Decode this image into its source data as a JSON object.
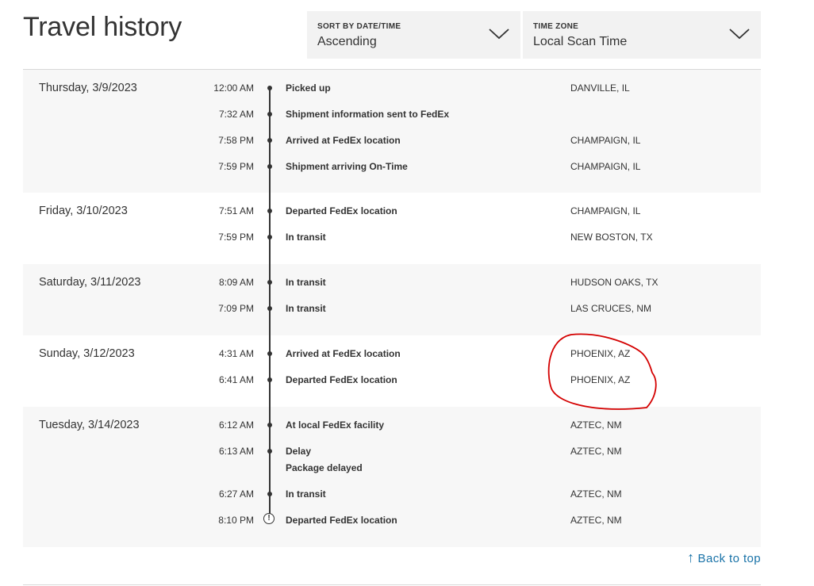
{
  "page": {
    "title": "Travel history"
  },
  "controls": {
    "sort": {
      "label": "SORT BY DATE/TIME",
      "value": "Ascending"
    },
    "timezone": {
      "label": "TIME ZONE",
      "value": "Local Scan Time"
    }
  },
  "history": [
    {
      "date": "Thursday, 3/9/2023",
      "events": [
        {
          "time": "12:00 AM",
          "description": "Picked up",
          "location": "DANVILLE, IL"
        },
        {
          "time": "7:32 AM",
          "description": "Shipment information sent to FedEx",
          "location": ""
        },
        {
          "time": "7:58 PM",
          "description": "Arrived at FedEx location",
          "location": "CHAMPAIGN, IL"
        },
        {
          "time": "7:59 PM",
          "description": "Shipment arriving On-Time",
          "location": "CHAMPAIGN, IL"
        }
      ]
    },
    {
      "date": "Friday, 3/10/2023",
      "events": [
        {
          "time": "7:51 AM",
          "description": "Departed FedEx location",
          "location": "CHAMPAIGN, IL"
        },
        {
          "time": "7:59 PM",
          "description": "In transit",
          "location": "NEW BOSTON, TX"
        }
      ]
    },
    {
      "date": "Saturday, 3/11/2023",
      "events": [
        {
          "time": "8:09 AM",
          "description": "In transit",
          "location": "HUDSON OAKS, TX"
        },
        {
          "time": "7:09 PM",
          "description": "In transit",
          "location": "LAS CRUCES, NM"
        }
      ]
    },
    {
      "date": "Sunday, 3/12/2023",
      "events": [
        {
          "time": "4:31 AM",
          "description": "Arrived at FedEx location",
          "location": "PHOENIX, AZ"
        },
        {
          "time": "6:41 AM",
          "description": "Departed FedEx location",
          "location": "PHOENIX, AZ"
        }
      ]
    },
    {
      "date": "Tuesday, 3/14/2023",
      "events": [
        {
          "time": "6:12 AM",
          "description": "At local FedEx facility",
          "location": "AZTEC, NM"
        },
        {
          "time": "6:13 AM",
          "description": "Delay",
          "sub": "Package delayed",
          "location": "AZTEC, NM"
        },
        {
          "time": "6:27 AM",
          "description": "In transit",
          "location": "AZTEC, NM"
        },
        {
          "time": "8:10 PM",
          "description": "Departed FedEx location",
          "location": "AZTEC, NM",
          "marker": "alert"
        }
      ]
    }
  ],
  "footer": {
    "back_to_top": "Back to top",
    "arrow": "↑"
  },
  "colors": {
    "link": "#1a73a8",
    "shade": "#f7f7f7",
    "annotation": "#d40000"
  },
  "icons": {
    "dropdown": "chevron-down-icon",
    "alert": "alert-circle-icon",
    "back": "arrow-up-icon"
  }
}
